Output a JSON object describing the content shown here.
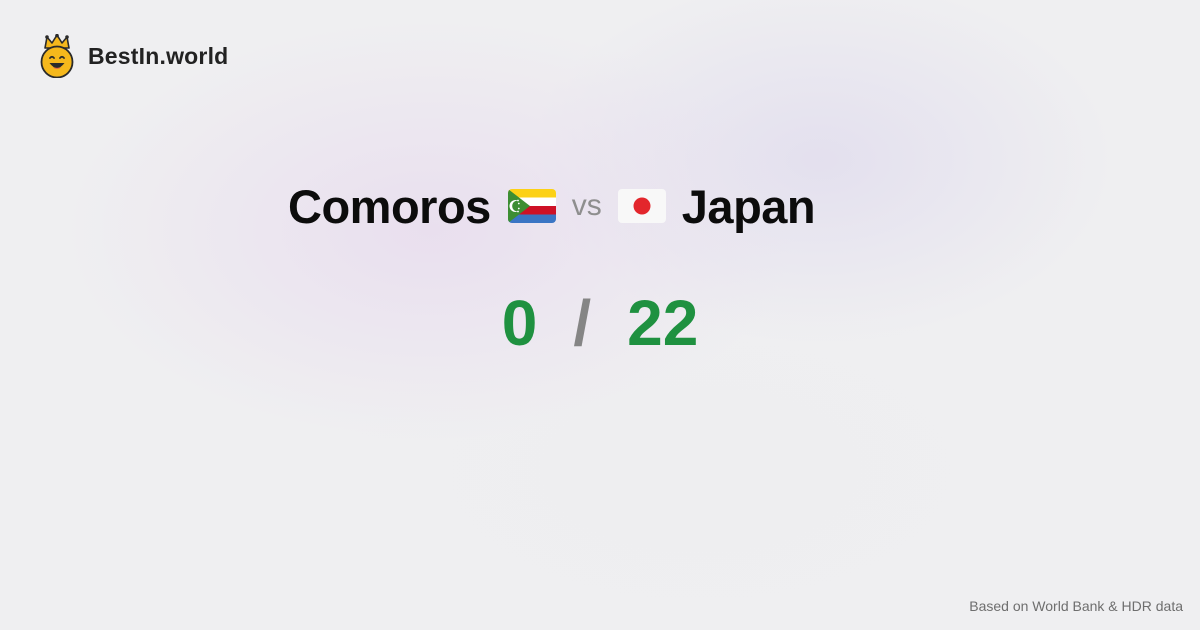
{
  "brand": {
    "name": "BestIn.world",
    "logo_icon": "crown-smiley-icon"
  },
  "comparison": {
    "left": {
      "name": "Comoros",
      "flag_icon": "comoros-flag-icon",
      "score": "0"
    },
    "vs_label": "vs",
    "right": {
      "name": "Japan",
      "flag_icon": "japan-flag-icon",
      "score": "22"
    },
    "separator": "/"
  },
  "footer": {
    "source_note": "Based on World Bank & HDR data"
  },
  "colors": {
    "score_green": "#1f9140",
    "separator_gray": "#858585",
    "vs_gray": "#8e8e8e"
  }
}
